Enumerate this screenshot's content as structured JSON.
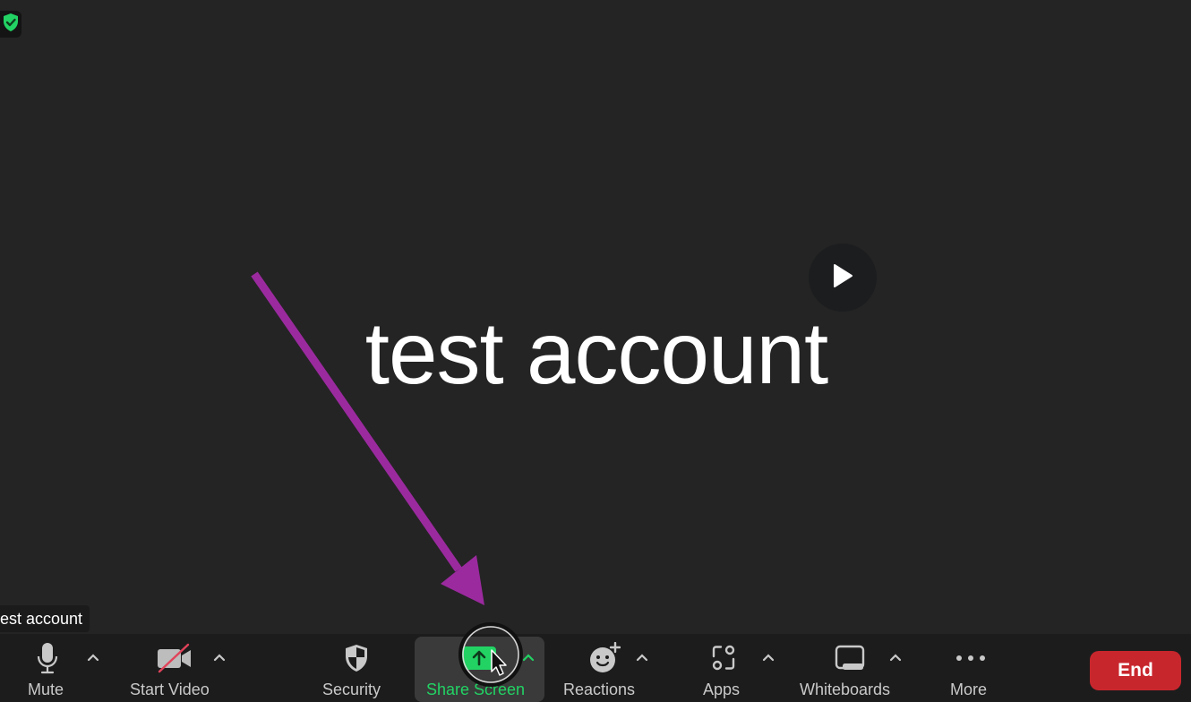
{
  "meeting": {
    "participant_display_name": "test account",
    "participant_name_label": "est account",
    "security_status": "encrypted"
  },
  "toolbar": {
    "items": [
      {
        "label": "Mute",
        "icon": "microphone-icon",
        "has_caret": true
      },
      {
        "label": "Start Video",
        "icon": "video-off-icon",
        "has_caret": true
      },
      {
        "label": "Security",
        "icon": "shield-icon",
        "has_caret": false
      },
      {
        "label": "Share Screen",
        "icon": "share-screen-icon",
        "has_caret": true,
        "active": true
      },
      {
        "label": "Reactions",
        "icon": "reactions-icon",
        "has_caret": true
      },
      {
        "label": "Apps",
        "icon": "apps-icon",
        "has_caret": true
      },
      {
        "label": "Whiteboards",
        "icon": "whiteboard-icon",
        "has_caret": true
      },
      {
        "label": "More",
        "icon": "more-icon",
        "has_caret": false
      }
    ],
    "end_label": "End"
  },
  "colors": {
    "accent_green": "#22d364",
    "end_red": "#c8262d",
    "annotation_arrow": "#9b2a9f",
    "background": "#242424"
  },
  "annotation": {
    "type": "arrow",
    "points_to": "Share Screen"
  }
}
